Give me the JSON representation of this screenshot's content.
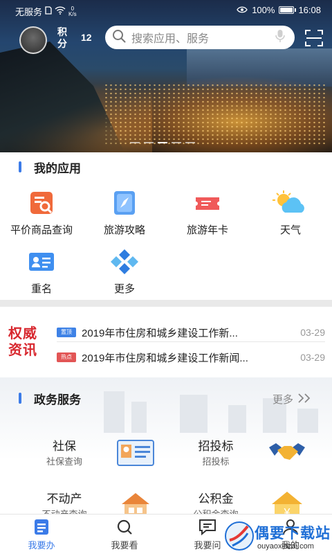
{
  "status_bar": {
    "carrier": "无服务",
    "speed_value": "0",
    "speed_unit": "K/s",
    "battery": "100%",
    "time": "16:08"
  },
  "header": {
    "points_label": "积分",
    "points_value": "12",
    "search_placeholder": "搜索应用、服务"
  },
  "my_apps": {
    "title": "我的应用",
    "items": [
      {
        "label": "平价商品查询",
        "icon": "price-search-icon"
      },
      {
        "label": "旅游攻略",
        "icon": "compass-icon"
      },
      {
        "label": "旅游年卡",
        "icon": "ticket-card-icon"
      },
      {
        "label": "天气",
        "icon": "weather-icon"
      },
      {
        "label": "重名",
        "icon": "id-card-icon"
      },
      {
        "label": "更多",
        "icon": "more-diamonds-icon"
      }
    ]
  },
  "news": {
    "logo_line1": "权威",
    "logo_line2": "资讯",
    "items": [
      {
        "tag": "置顶",
        "title": "2019年市住房和城乡建设工作新...",
        "date": "03-29"
      },
      {
        "tag": "热点",
        "title": "2019年市住房和城乡建设工作新闻...",
        "date": "03-29"
      }
    ]
  },
  "gov_services": {
    "title": "政务服务",
    "more": "更多",
    "items": [
      {
        "name": "社保",
        "sub": "社保查询",
        "icon": "social-security-card-icon"
      },
      {
        "name": "招投标",
        "sub": "招投标",
        "icon": "handshake-icon"
      },
      {
        "name": "不动产",
        "sub": "不动产查询",
        "icon": "house-icon"
      },
      {
        "name": "公积金",
        "sub": "公积金查询",
        "icon": "yuan-house-icon"
      }
    ]
  },
  "bottom_nav": [
    {
      "label": "我要办",
      "active": true
    },
    {
      "label": "我要看",
      "active": false
    },
    {
      "label": "我要问",
      "active": false
    },
    {
      "label": "我的",
      "active": false
    }
  ],
  "watermark": {
    "text": "偶要下载站",
    "url": "ouyaoxiazai.com"
  },
  "colors": {
    "accent": "#3b7be8",
    "news_red": "#d8282f",
    "divider": "#e9e9e9"
  }
}
